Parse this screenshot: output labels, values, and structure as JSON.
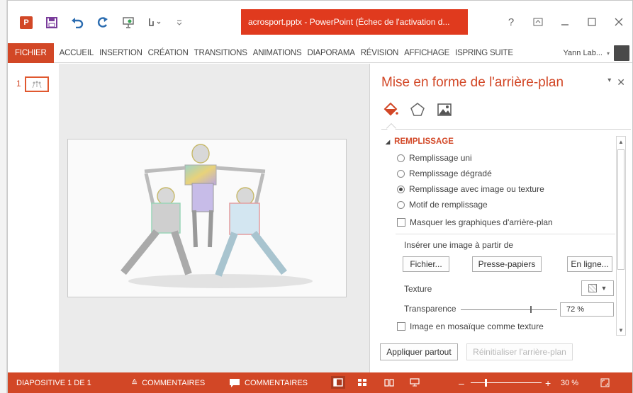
{
  "window": {
    "title": "acrosport.pptx - PowerPoint (Échec de l'activation d...",
    "controls": [
      "?",
      "restore-ribbon",
      "minimize",
      "maximize",
      "close"
    ]
  },
  "quick_access": [
    {
      "name": "save-icon",
      "glyph": "🖫"
    },
    {
      "name": "undo-icon",
      "glyph": "↶"
    },
    {
      "name": "redo-icon",
      "glyph": "↻"
    },
    {
      "name": "present-icon",
      "glyph": "▣"
    },
    {
      "name": "touch-mode-icon",
      "glyph": "☝"
    },
    {
      "name": "customize-icon",
      "glyph": "≡"
    }
  ],
  "ribbon": {
    "tabs": [
      "FICHIER",
      "ACCUEIL",
      "INSERTION",
      "CRÉATION",
      "TRANSITIONS",
      "ANIMATIONS",
      "DIAPORAMA",
      "RÉVISION",
      "AFFICHAGE",
      "ISPRING SUITE"
    ],
    "user": "Yann Lab..."
  },
  "thumbnails": {
    "slide_number": "1"
  },
  "format_pane": {
    "title": "Mise en forme de l'arrière-plan",
    "section": "REMPLISSAGE",
    "fill_options": [
      {
        "label": "Remplissage uni",
        "selected": false
      },
      {
        "label": "Remplissage dégradé",
        "selected": false
      },
      {
        "label": "Remplissage avec image ou texture",
        "selected": true
      },
      {
        "label": "Motif de remplissage",
        "selected": false
      }
    ],
    "hide_graphics": "Masquer les graphiques d'arrière-plan",
    "insert_from": "Insérer une image à partir de",
    "btn_file": "Fichier...",
    "btn_clipboard": "Presse-papiers",
    "btn_online": "En ligne...",
    "texture_label": "Texture",
    "transparency_label": "Transparence",
    "transparency_value": "72 %",
    "transparency_fraction": 0.72,
    "tile_label": "Image en mosaïque comme texture",
    "apply_all": "Appliquer partout",
    "reset_bg": "Réinitialiser l'arrière-plan"
  },
  "status_bar": {
    "slide_info": "DIAPOSITIVE 1 DE 1",
    "notes": "COMMENTAIRES",
    "comments": "COMMENTAIRES",
    "zoom": "30 %",
    "accent": "#d24726"
  }
}
